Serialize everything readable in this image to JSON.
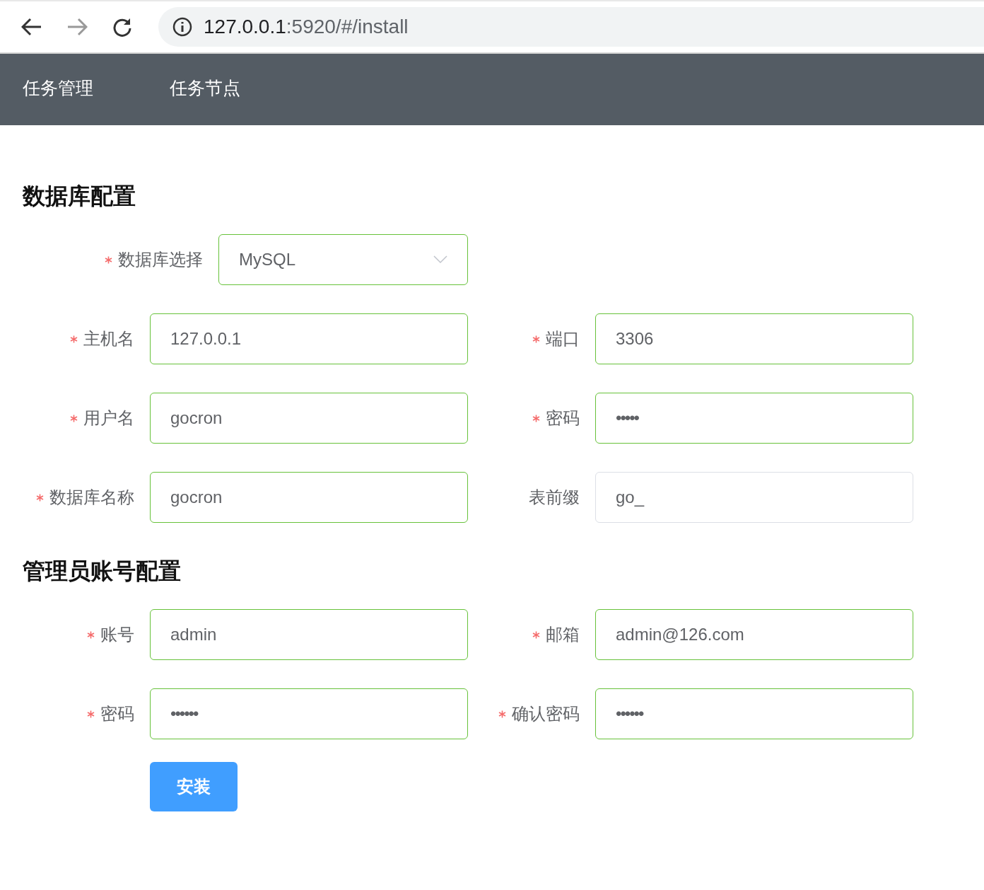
{
  "browser": {
    "url_host": "127.0.0.1",
    "url_rest": ":5920/#/install",
    "forward_disabled": true
  },
  "nav": [
    {
      "label": "任务管理",
      "selected": false
    },
    {
      "label": "任务节点",
      "selected": false
    }
  ],
  "sections": [
    {
      "title": "数据库配置",
      "rows": [
        [
          {
            "kind": "select",
            "label": "数据库选择",
            "required": true,
            "valid": true,
            "value": "MySQL"
          }
        ],
        [
          {
            "kind": "text",
            "label": "主机名",
            "required": true,
            "valid": true,
            "value": "127.0.0.1"
          },
          {
            "kind": "text",
            "label": "端口",
            "required": true,
            "valid": true,
            "value": "3306"
          }
        ],
        [
          {
            "kind": "text",
            "label": "用户名",
            "required": true,
            "valid": true,
            "value": "gocron"
          },
          {
            "kind": "password",
            "label": "密码",
            "required": true,
            "valid": true,
            "value": "•••••"
          }
        ],
        [
          {
            "kind": "text",
            "label": "数据库名称",
            "required": true,
            "valid": true,
            "value": "gocron"
          },
          {
            "kind": "text",
            "label": "表前缀",
            "required": false,
            "valid": false,
            "value": "go_"
          }
        ]
      ]
    },
    {
      "title": "管理员账号配置",
      "rows": [
        [
          {
            "kind": "text",
            "label": "账号",
            "required": true,
            "valid": true,
            "value": "admin"
          },
          {
            "kind": "text",
            "label": "邮箱",
            "required": true,
            "valid": true,
            "value": "admin@126.com"
          }
        ],
        [
          {
            "kind": "password",
            "label": "密码",
            "required": true,
            "valid": true,
            "value": "••••••"
          },
          {
            "kind": "password",
            "label": "确认密码",
            "required": true,
            "valid": true,
            "value": "••••••"
          }
        ]
      ]
    }
  ],
  "submit": {
    "label": "安装"
  }
}
